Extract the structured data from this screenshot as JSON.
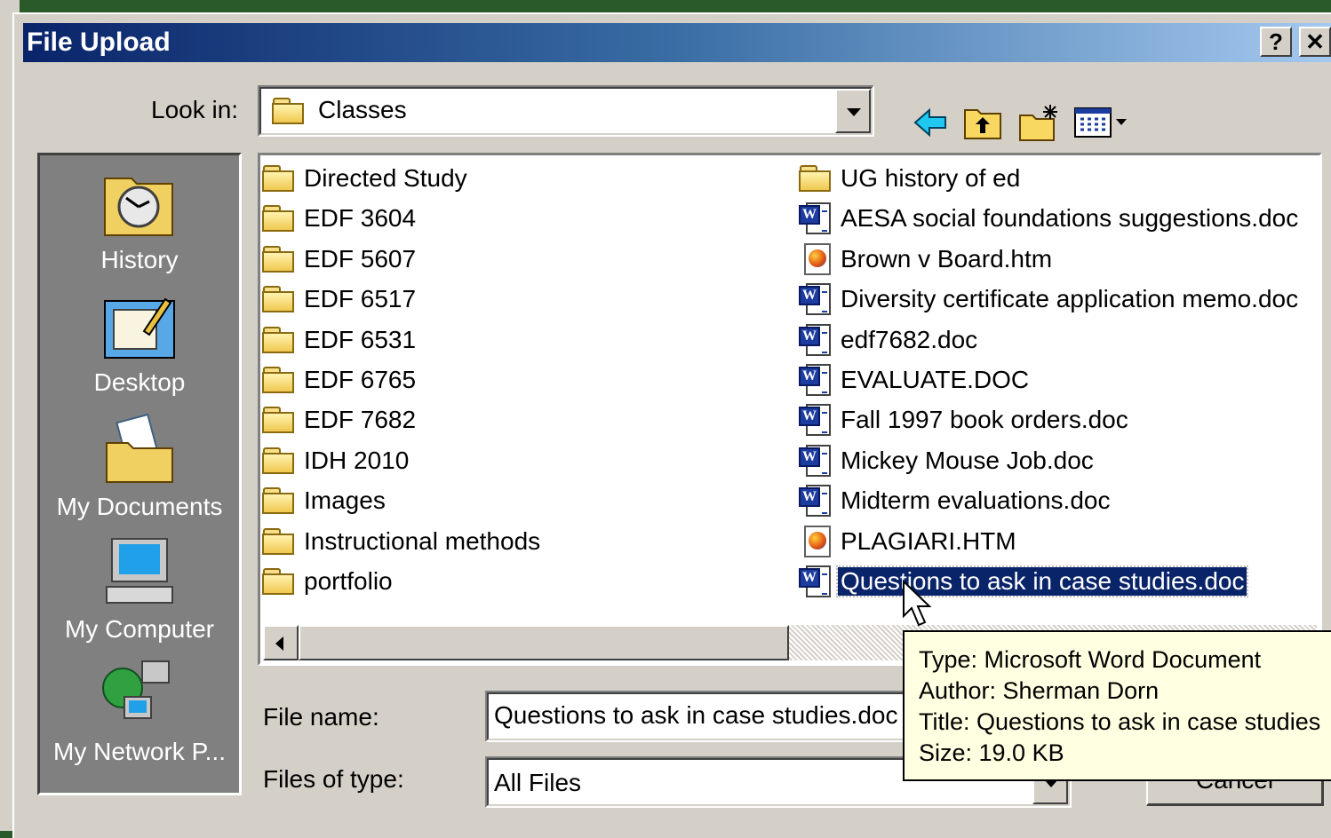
{
  "window": {
    "title": "File Upload",
    "help_label": "?",
    "close_label": "✕"
  },
  "lookin": {
    "label": "Look in:",
    "value": "Classes"
  },
  "toolbar": {
    "back": "back-arrow-icon",
    "up": "up-folder-icon",
    "new": "new-folder-icon",
    "view": "view-menu-icon"
  },
  "places": [
    {
      "label": "History",
      "icon": "history-icon"
    },
    {
      "label": "Desktop",
      "icon": "desktop-icon"
    },
    {
      "label": "My Documents",
      "icon": "my-documents-icon"
    },
    {
      "label": "My Computer",
      "icon": "my-computer-icon"
    },
    {
      "label": "My Network P...",
      "icon": "my-network-places-icon"
    }
  ],
  "files_left": [
    "Directed Study",
    "EDF 3604",
    "EDF 5607",
    "EDF 6517",
    "EDF 6531",
    "EDF 6765",
    "EDF 7682",
    "IDH 2010",
    "Images",
    "Instructional methods",
    "portfolio"
  ],
  "files_right": [
    {
      "name": "UG history of ed",
      "type": "folder"
    },
    {
      "name": "AESA social foundations suggestions.doc",
      "type": "word"
    },
    {
      "name": "Brown v Board.htm",
      "type": "html"
    },
    {
      "name": "Diversity certificate application memo.doc",
      "type": "word"
    },
    {
      "name": "edf7682.doc",
      "type": "word"
    },
    {
      "name": "EVALUATE.DOC",
      "type": "word"
    },
    {
      "name": "Fall 1997 book orders.doc",
      "type": "word"
    },
    {
      "name": "Mickey Mouse Job.doc",
      "type": "word"
    },
    {
      "name": "Midterm evaluations.doc",
      "type": "word"
    },
    {
      "name": "PLAGIARI.HTM",
      "type": "html"
    },
    {
      "name": "Questions to ask in case studies.doc",
      "type": "word",
      "selected": true
    }
  ],
  "filename": {
    "label": "File name:",
    "value": "Questions to ask in case studies.doc"
  },
  "filetype": {
    "label": "Files of type:",
    "value": "All Files"
  },
  "tooltip": {
    "type": "Type: Microsoft Word Document",
    "author": "Author: Sherman Dorn",
    "title": "Title: Questions to ask in case studies",
    "size": "Size: 19.0 KB"
  },
  "buttons": {
    "cancel": "Cancel"
  }
}
